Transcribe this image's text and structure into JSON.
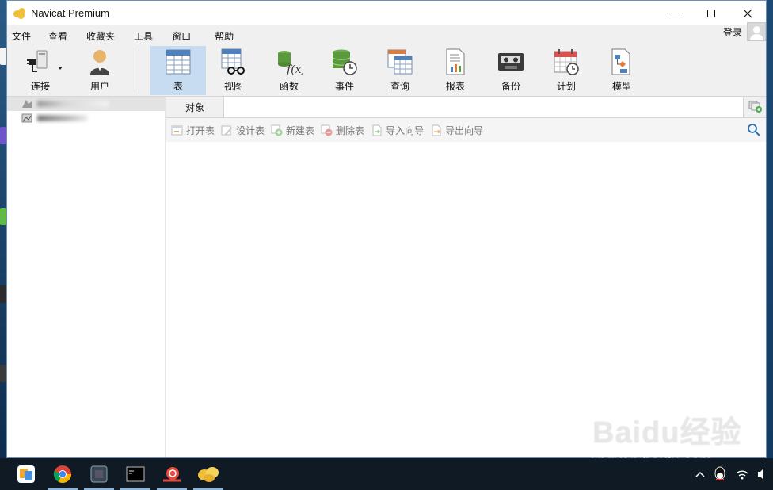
{
  "window": {
    "title": "Navicat Premium"
  },
  "menu": [
    {
      "label": "文件"
    },
    {
      "label": "查看"
    },
    {
      "label": "收藏夹"
    },
    {
      "label": "工具"
    },
    {
      "label": "窗口"
    },
    {
      "label": "帮助"
    }
  ],
  "login": {
    "label": "登录"
  },
  "toolbar": {
    "connect": "连接",
    "user": "用户",
    "table": "表",
    "view": "视图",
    "function": "函数",
    "event": "事件",
    "query": "查询",
    "report": "报表",
    "backup": "备份",
    "schedule": "计划",
    "model": "模型"
  },
  "tabs": {
    "objects": "对象"
  },
  "actions": {
    "open_table": "打开表",
    "design_table": "设计表",
    "new_table": "新建表",
    "delete_table": "删除表",
    "import_wizard": "导入向导",
    "export_wizard": "导出向导"
  },
  "watermark": {
    "logo": "Baidu经验",
    "url": "jingyan.baidu.com"
  },
  "colors": {
    "active_tool": "#c7dcf1",
    "toolbar_bg": "#f0f0f0",
    "taskbar": "#101a24"
  }
}
